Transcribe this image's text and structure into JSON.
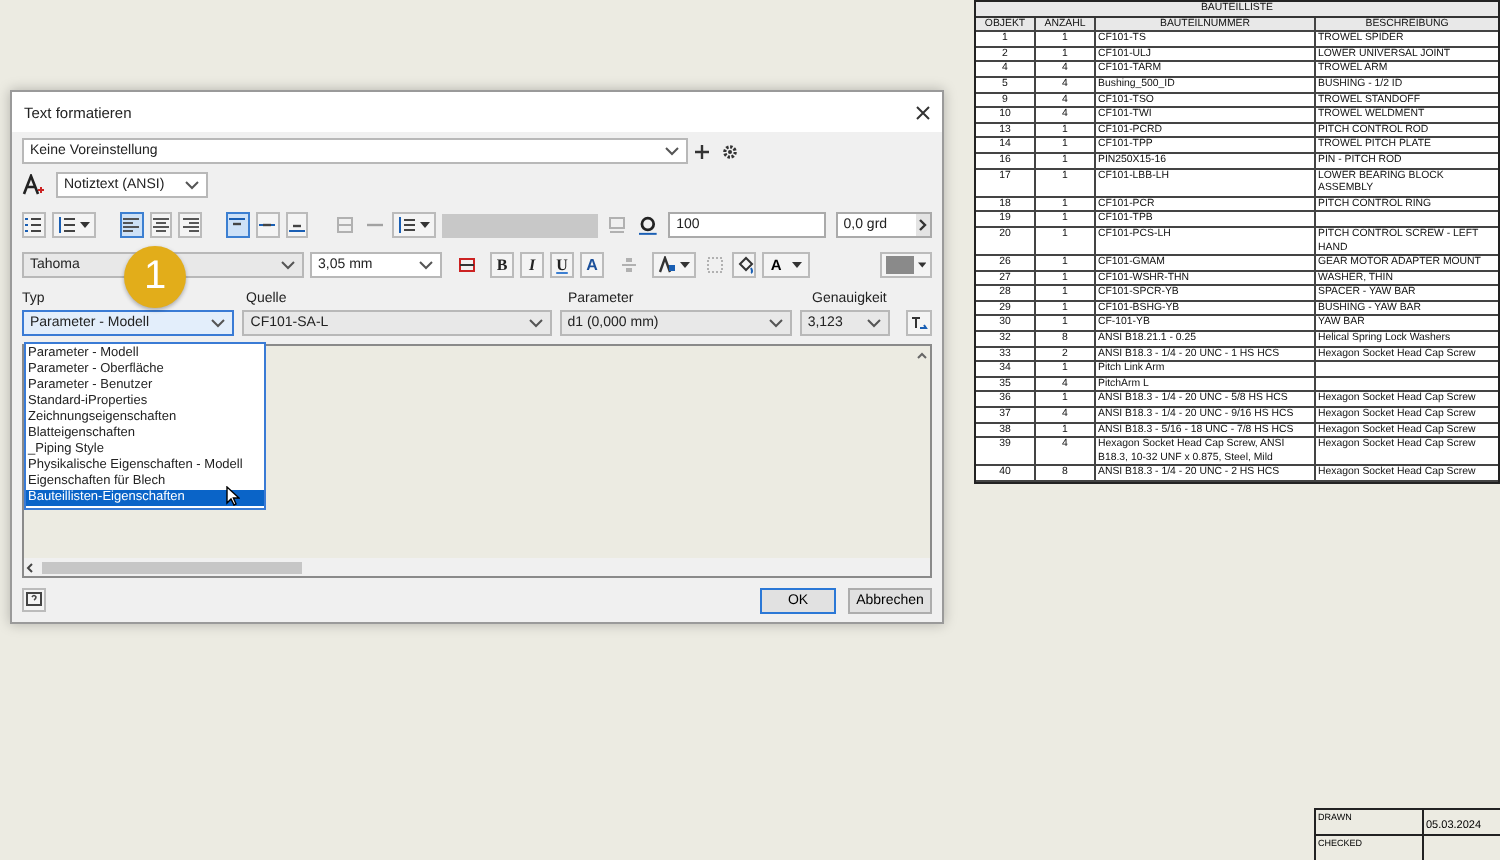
{
  "dialog": {
    "title": "Text formatieren",
    "preset": {
      "value": "Keine Voreinstellung"
    },
    "style": {
      "value": "Notiztext (ANSI)"
    },
    "horizontal_alignment": [
      {
        "selected": true
      },
      {
        "selected": false
      },
      {
        "selected": false
      }
    ],
    "vertical_alignment": [
      {
        "selected": true
      },
      {
        "selected": false
      },
      {
        "selected": false
      }
    ],
    "line_spacing": {
      "value": "100"
    },
    "rotation": {
      "value": "0,0 grd"
    },
    "font": {
      "family": "Tahoma",
      "size": "3,05 mm"
    },
    "format_buttons": [
      {
        "label": "B",
        "kind": "bold",
        "selected": false
      },
      {
        "label": "I",
        "kind": "italic",
        "selected": false
      },
      {
        "label": "U",
        "kind": "underline",
        "selected": false
      },
      {
        "label": "A",
        "kind": "strike",
        "selected": false
      }
    ],
    "text_color": {
      "label": "A"
    },
    "fields": [
      {
        "label": "Typ",
        "value": "Parameter - Modell",
        "expanded": true
      },
      {
        "label": "Quelle",
        "value": "CF101-SA-L",
        "expanded": false
      },
      {
        "label": "Parameter",
        "value": "d1 (0,000 mm)",
        "expanded": false
      },
      {
        "label": "Genauigkeit",
        "value": "3,123",
        "expanded": false
      }
    ],
    "type_options": [
      {
        "label": "Parameter - Modell",
        "selected": false
      },
      {
        "label": "Parameter - Oberfläche",
        "selected": false
      },
      {
        "label": "Parameter - Benutzer",
        "selected": false
      },
      {
        "label": "Standard-iProperties",
        "selected": false
      },
      {
        "label": "Zeichnungseigenschaften",
        "selected": false
      },
      {
        "label": "Blatteigenschaften",
        "selected": false
      },
      {
        "label": "_Piping Style",
        "selected": false
      },
      {
        "label": "Physikalische Eigenschaften - Modell",
        "selected": false
      },
      {
        "label": "Eigenschaften für Blech",
        "selected": false
      },
      {
        "label": "Bauteillisten-Eigenschaften",
        "selected": true
      }
    ],
    "buttons": [
      {
        "label": "OK",
        "default": true
      },
      {
        "label": "Abbrechen",
        "default": false
      }
    ]
  },
  "step_badge": "1",
  "parts_list": {
    "title": "BAUTEILLISTE",
    "columns": [
      "OBJEKT",
      "ANZAHL",
      "BAUTEILNUMMER",
      "BESCHREIBUNG"
    ],
    "rows": [
      [
        "1",
        "1",
        "CF101-TS",
        "TROWEL SPIDER"
      ],
      [
        "2",
        "1",
        "CF101-ULJ",
        "LOWER UNIVERSAL JOINT"
      ],
      [
        "4",
        "4",
        "CF101-TARM",
        "TROWEL ARM"
      ],
      [
        "5",
        "4",
        "Bushing_500_ID",
        "BUSHING - 1/2 ID"
      ],
      [
        "9",
        "4",
        "CF101-TSO",
        "TROWEL STANDOFF"
      ],
      [
        "10",
        "4",
        "CF101-TWI",
        "TROWEL WELDMENT"
      ],
      [
        "13",
        "1",
        "CF101-PCRD",
        "PITCH CONTROL ROD"
      ],
      [
        "14",
        "1",
        "CF101-TPP",
        "TROWEL PITCH PLATE"
      ],
      [
        "16",
        "1",
        "PIN250X15-16",
        "PIN - PITCH ROD"
      ],
      [
        "17",
        "1",
        "CF101-LBB-LH",
        "LOWER BEARING BLOCK ASSEMBLY"
      ],
      [
        "18",
        "1",
        "CF101-PCR",
        "PITCH CONTROL RING"
      ],
      [
        "19",
        "1",
        "CF101-TPB"
      ],
      [
        "20",
        "1",
        "CF101-PCS-LH",
        "PITCH CONTROL SCREW - LEFT HAND"
      ],
      [
        "26",
        "1",
        "CF101-GMAM",
        "GEAR MOTOR ADAPTER MOUNT"
      ],
      [
        "27",
        "1",
        "CF101-WSHR-THN",
        "WASHER, THIN"
      ],
      [
        "28",
        "1",
        "CF101-SPCR-YB",
        "SPACER - YAW BAR"
      ],
      [
        "29",
        "1",
        "CF101-BSHG-YB",
        "BUSHING - YAW BAR"
      ],
      [
        "30",
        "1",
        "CF-101-YB",
        "YAW BAR"
      ],
      [
        "32",
        "8",
        "ANSI B18.21.1 - 0.25",
        "Helical Spring Lock Washers"
      ],
      [
        "33",
        "2",
        "ANSI B18.3 - 1/4 - 20 UNC - 1 HS HCS",
        "Hexagon Socket Head Cap Screw"
      ],
      [
        "34",
        "1",
        "Pitch Link Arm"
      ],
      [
        "35",
        "4",
        "PitchArm L"
      ],
      [
        "36",
        "1",
        "ANSI B18.3 - 1/4 - 20 UNC - 5/8 HS HCS",
        "Hexagon Socket Head Cap Screw"
      ],
      [
        "37",
        "4",
        "ANSI B18.3 - 1/4 - 20 UNC - 9/16 HS HCS",
        "Hexagon Socket Head Cap Screw"
      ],
      [
        "38",
        "1",
        "ANSI B18.3 - 5/16 - 18 UNC - 7/8 HS HCS",
        "Hexagon Socket Head Cap Screw"
      ],
      [
        "39",
        "4",
        "Hexagon Socket Head Cap Screw, ANSI B18.3, 10-32 UNF x 0.875, Steel, Mild",
        "Hexagon Socket Head Cap Screw"
      ],
      [
        "40",
        "8",
        "ANSI B18.3 - 1/4 - 20 UNC - 2 HS HCS",
        "Hexagon Socket Head Cap Screw"
      ]
    ]
  },
  "title_block": {
    "rows": [
      {
        "label": "DRAWN",
        "date": "05.03.2024"
      },
      {
        "label": "CHECKED"
      }
    ]
  }
}
